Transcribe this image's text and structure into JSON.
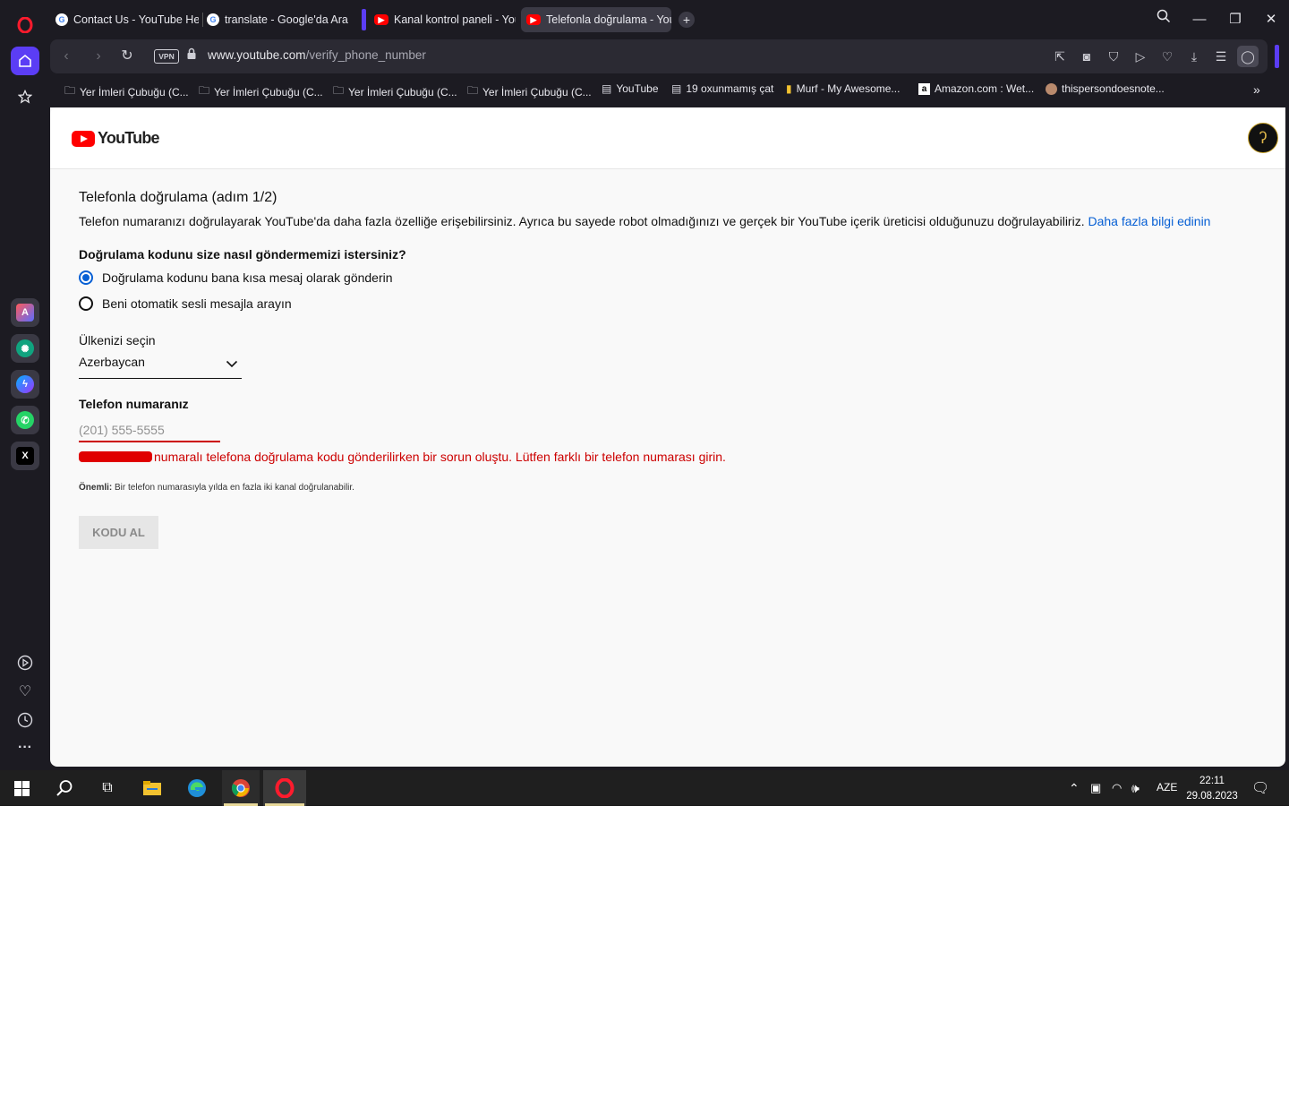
{
  "browser": {
    "tabs": [
      {
        "title": "Contact Us - YouTube Hel",
        "icon": "google-icon",
        "active": false
      },
      {
        "title": "translate - Google'da Ara",
        "icon": "google-icon",
        "active": false
      },
      {
        "title": "Kanal kontrol paneli - You",
        "icon": "youtube-icon",
        "active": false
      },
      {
        "title": "Telefonla doğrulama - You",
        "icon": "youtube-icon",
        "active": true
      }
    ],
    "url_host": "www.youtube.com",
    "url_path": "/verify_phone_number",
    "vpn_label": "VPN",
    "accent_color": "#5b3df5"
  },
  "bookmarks": [
    {
      "label": "Yer İmleri Çubuğu (C...",
      "icon": "folder-icon"
    },
    {
      "label": "Yer İmleri Çubuğu (C...",
      "icon": "folder-icon"
    },
    {
      "label": "Yer İmleri Çubuğu (C...",
      "icon": "folder-icon"
    },
    {
      "label": "Yer İmleri Çubuğu (C...",
      "icon": "folder-icon"
    },
    {
      "label": "YouTube",
      "icon": "page-icon"
    },
    {
      "label": "19 oxunmamış çat",
      "icon": "page-icon"
    },
    {
      "label": "Murf - My Awesome...",
      "icon": "murf-icon"
    },
    {
      "label": "Amazon.com : Wet...",
      "icon": "amazon-icon"
    },
    {
      "label": "thispersondoesnote...",
      "icon": "person-icon"
    }
  ],
  "page": {
    "logo_text": "YouTube",
    "title": "Telefonla doğrulama (adım 1/2)",
    "description": "Telefon numaranızı doğrulayarak YouTube'da daha fazla özelliğe erişebilirsiniz. Ayrıca bu sayede robot olmadığınızı ve gerçek bir YouTube içerik üreticisi olduğunuzu doğrulayabiliriz.",
    "learn_more": "Daha fazla bilgi edinin",
    "question": "Doğrulama kodunu size nasıl göndermemizi istersiniz?",
    "options": [
      {
        "label": "Doğrulama kodunu bana kısa mesaj olarak gönderin",
        "selected": true
      },
      {
        "label": "Beni otomatik sesli mesajla arayın",
        "selected": false
      }
    ],
    "country_label": "Ülkenizi seçin",
    "country_value": "Azerbaycan",
    "phone_label": "Telefon numaranız",
    "phone_placeholder": "(201) 555-5555",
    "phone_value": "",
    "error_text": "numaralı telefona doğrulama kodu gönderilirken bir sorun oluştu. Lütfen farklı bir telefon numarası girin.",
    "note_bold": "Önemli:",
    "note_text": "Bir telefon numarasıyla yılda en fazla iki kanal doğrulanabilir.",
    "submit_label": "KODU AL",
    "error_color": "#cc0000",
    "link_color": "#065fd4"
  },
  "taskbar": {
    "language": "AZE",
    "time": "22:11",
    "date": "29.08.2023"
  }
}
